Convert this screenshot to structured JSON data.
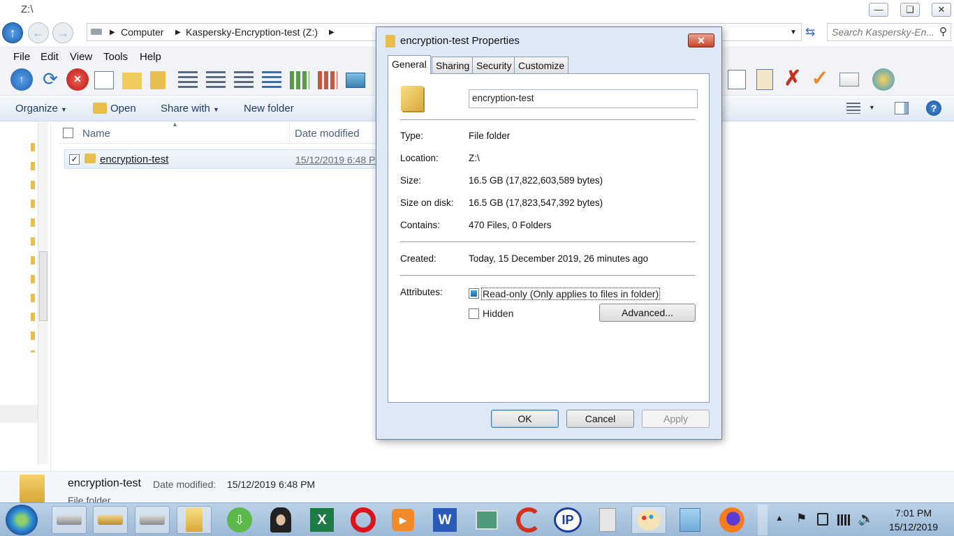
{
  "explorer": {
    "title": "Z:\\",
    "breadcrumb": [
      "Computer",
      "Kaspersky-Encryption-test (Z:)"
    ],
    "search_placeholder": "Search Kaspersky-En...",
    "menus": [
      "File",
      "Edit",
      "View",
      "Tools",
      "Help"
    ],
    "commands": {
      "organize": "Organize",
      "open": "Open",
      "share_with": "Share with",
      "new_folder": "New folder"
    },
    "columns": {
      "name": "Name",
      "date_modified": "Date modified"
    },
    "file": {
      "name": "encryption-test",
      "date": "15/12/2019 6:48 P"
    },
    "details": {
      "name": "encryption-test",
      "date_label": "Date modified:",
      "date_value": "15/12/2019 6:48 PM",
      "type": "File folder"
    }
  },
  "dialog": {
    "title": "encryption-test Properties",
    "tabs": [
      "General",
      "Sharing",
      "Security",
      "Customize"
    ],
    "folder_name": "encryption-test",
    "fields": {
      "type_label": "Type:",
      "type_value": "File folder",
      "location_label": "Location:",
      "location_value": "Z:\\",
      "size_label": "Size:",
      "size_value": "16.5 GB (17,822,603,589 bytes)",
      "size_on_disk_label": "Size on disk:",
      "size_on_disk_value": "16.5 GB (17,823,547,392 bytes)",
      "contains_label": "Contains:",
      "contains_value": "470 Files, 0 Folders",
      "created_label": "Created:",
      "created_value": "Today, 15 December 2019, 26 minutes ago",
      "attributes_label": "Attributes:"
    },
    "readonly_label": "Read-only (Only applies to files in folder)",
    "readonly_state": "indeterminate",
    "hidden_label": "Hidden",
    "advanced_label": "Advanced...",
    "ok_label": "OK",
    "cancel_label": "Cancel",
    "apply_label": "Apply"
  },
  "taskbar": {
    "time": "7:01 PM",
    "date": "15/12/2019"
  },
  "colors": {
    "accent": "#3c7fb1",
    "close": "#c7452a",
    "taskbar": "#9bb8d6"
  }
}
